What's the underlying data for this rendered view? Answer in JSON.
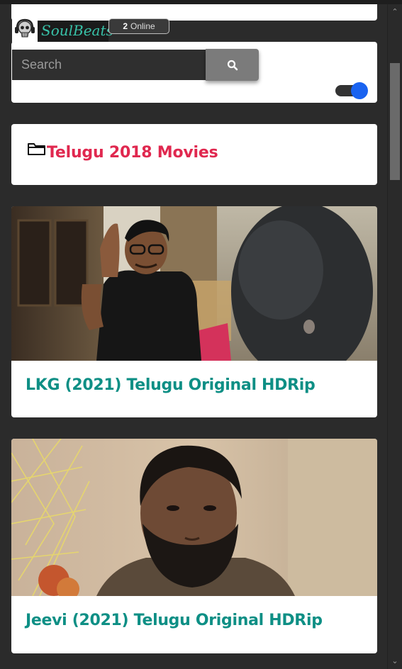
{
  "header": {
    "logo_text": "SoulBeats",
    "online_count": "2",
    "online_label": "Online"
  },
  "search": {
    "placeholder": "Search",
    "value": "",
    "dark_mode_enabled": true
  },
  "category": {
    "title": "Telugu 2018 Movies",
    "icon": "folder-icon"
  },
  "posts": [
    {
      "title": "LKG (2021) Telugu Original HDRip"
    },
    {
      "title": "Jeevi (2021) Telugu Original HDRip"
    }
  ],
  "colors": {
    "background": "#2b2b2b",
    "category_title": "#e0284f",
    "post_title": "#0e8f85",
    "logo": "#38c2a8",
    "toggle_knob": "#1a63f0"
  }
}
